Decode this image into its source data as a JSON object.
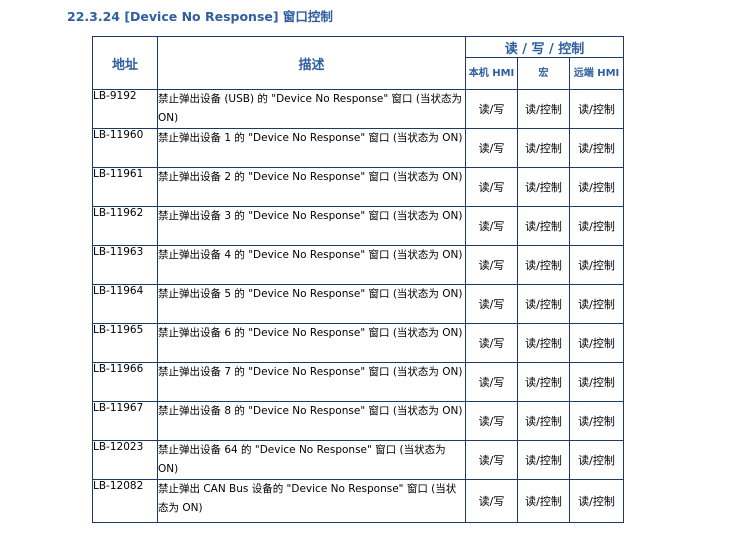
{
  "heading": "22.3.24 [Device No Response] 窗口控制",
  "table": {
    "header": {
      "address": "地址",
      "description": "描述",
      "rw_control": "读 / 写 / 控制",
      "local_hmi": "本机 HMI",
      "macro": "宏",
      "remote_hmi": "远端 HMI"
    },
    "rows": [
      {
        "address": "LB-9192",
        "description": "禁止弹出设备 (USB) 的 \"Device No Response\" 窗口 (当状态为 ON)",
        "local": "读/写",
        "macro": "读/控制",
        "remote": "读/控制"
      },
      {
        "address": "LB-11960",
        "description": "禁止弹出设备 1 的 \"Device No Response\" 窗口 (当状态为 ON)",
        "local": "读/写",
        "macro": "读/控制",
        "remote": "读/控制"
      },
      {
        "address": "LB-11961",
        "description": "禁止弹出设备 2 的 \"Device No Response\" 窗口 (当状态为 ON)",
        "local": "读/写",
        "macro": "读/控制",
        "remote": "读/控制"
      },
      {
        "address": "LB-11962",
        "description": "禁止弹出设备 3 的 \"Device No Response\" 窗口 (当状态为 ON)",
        "local": "读/写",
        "macro": "读/控制",
        "remote": "读/控制"
      },
      {
        "address": "LB-11963",
        "description": "禁止弹出设备 4 的 \"Device No Response\" 窗口 (当状态为 ON)",
        "local": "读/写",
        "macro": "读/控制",
        "remote": "读/控制"
      },
      {
        "address": "LB-11964",
        "description": "禁止弹出设备 5 的 \"Device No Response\" 窗口 (当状态为 ON)",
        "local": "读/写",
        "macro": "读/控制",
        "remote": "读/控制"
      },
      {
        "address": "LB-11965",
        "description": "禁止弹出设备 6 的 \"Device No Response\" 窗口 (当状态为 ON)",
        "local": "读/写",
        "macro": "读/控制",
        "remote": "读/控制"
      },
      {
        "address": "LB-11966",
        "description": "禁止弹出设备 7 的 \"Device No Response\" 窗口 (当状态为 ON)",
        "local": "读/写",
        "macro": "读/控制",
        "remote": "读/控制"
      },
      {
        "address": "LB-11967",
        "description": "禁止弹出设备 8 的 \"Device No Response\" 窗口 (当状态为 ON)",
        "local": "读/写",
        "macro": "读/控制",
        "remote": "读/控制"
      },
      {
        "address": "LB-12023",
        "description": "禁止弹出设备 64 的 \"Device No Response\" 窗口 (当状态为 ON)",
        "local": "读/写",
        "macro": "读/控制",
        "remote": "读/控制"
      },
      {
        "address": "LB-12082",
        "description": "禁止弹出 CAN Bus 设备的 \"Device No Response\" 窗口 (当状态为 ON)",
        "local": "读/写",
        "macro": "读/控制",
        "remote": "读/控制"
      }
    ]
  }
}
